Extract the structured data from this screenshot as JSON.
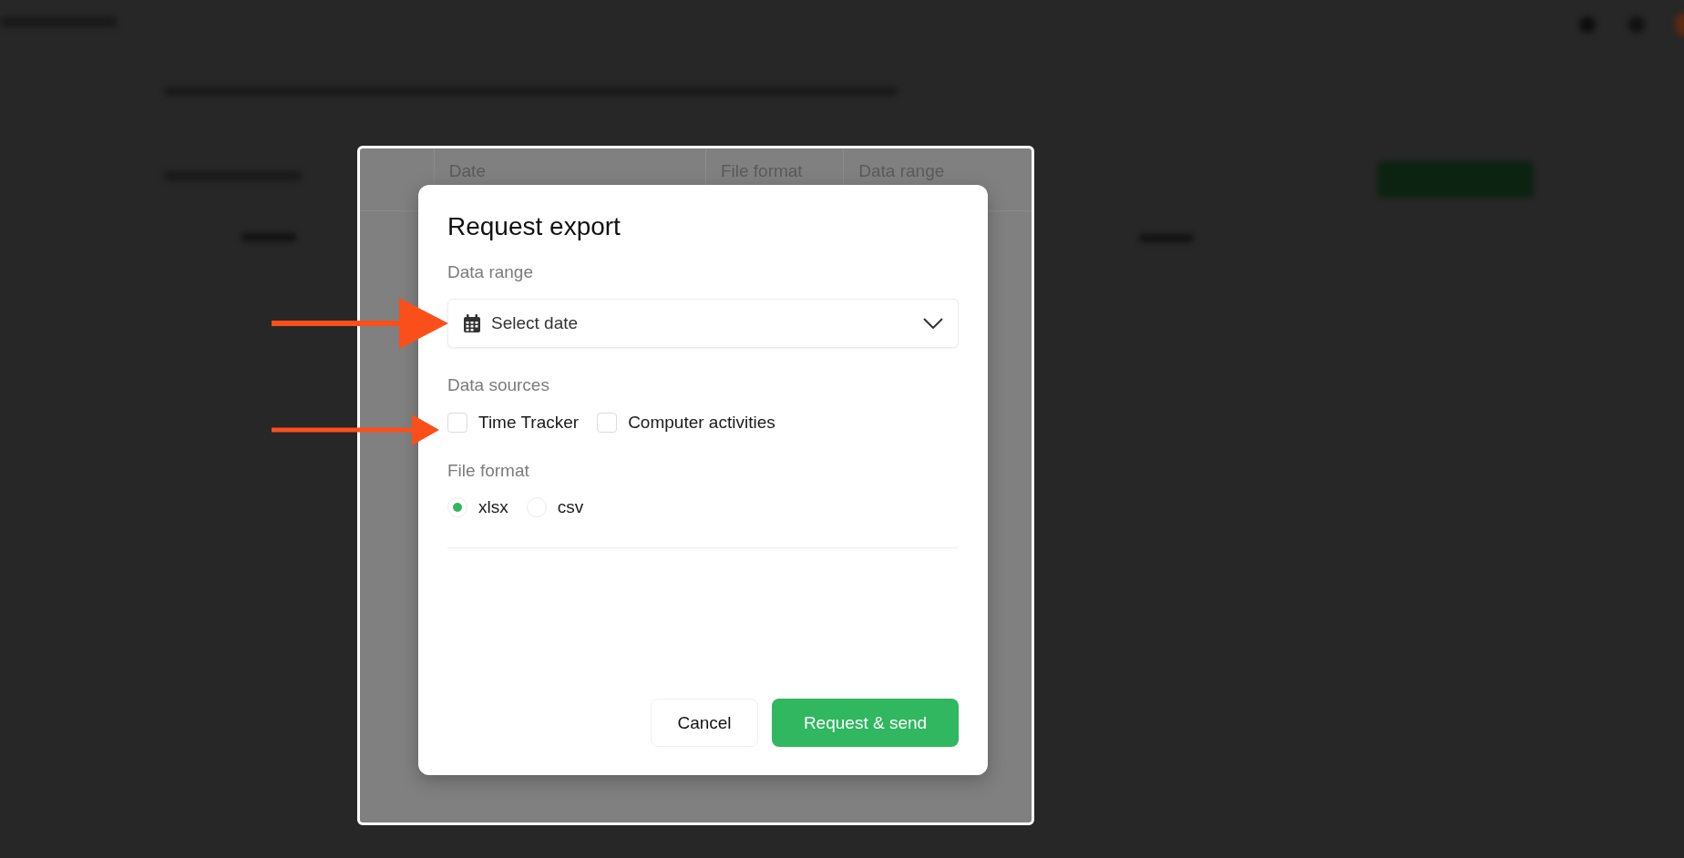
{
  "background_table": {
    "columns": [
      "Date",
      "File format",
      "Data range"
    ]
  },
  "modal": {
    "title": "Request export",
    "date_range": {
      "label": "Data range",
      "placeholder": "Select date"
    },
    "data_sources": {
      "label": "Data sources",
      "options": [
        {
          "label": "Time Tracker",
          "checked": false
        },
        {
          "label": "Computer activities",
          "checked": false
        }
      ]
    },
    "file_format": {
      "label": "File format",
      "options": [
        {
          "label": "xlsx",
          "selected": true
        },
        {
          "label": "csv",
          "selected": false
        }
      ]
    },
    "buttons": [
      {
        "label": "Cancel",
        "kind": "secondary"
      },
      {
        "label": "Request & send",
        "kind": "primary"
      }
    ]
  }
}
